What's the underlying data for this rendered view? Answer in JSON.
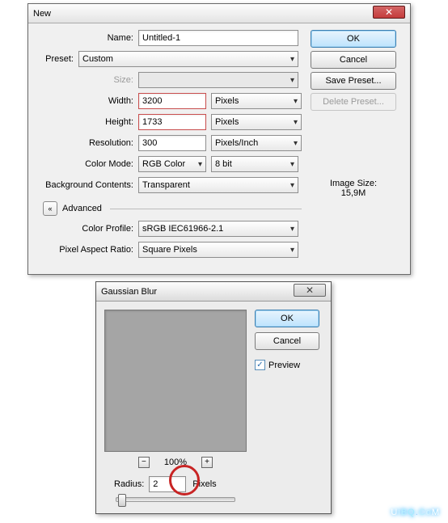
{
  "dlg1": {
    "title": "New",
    "name_label": "Name:",
    "name_value": "Untitled-1",
    "preset_label": "Preset:",
    "preset_value": "Custom",
    "size_label": "Size:",
    "size_value": "",
    "width_label": "Width:",
    "width_value": "3200",
    "width_unit": "Pixels",
    "height_label": "Height:",
    "height_value": "1733",
    "height_unit": "Pixels",
    "resolution_label": "Resolution:",
    "resolution_value": "300",
    "resolution_unit": "Pixels/Inch",
    "colormode_label": "Color Mode:",
    "colormode_value": "RGB Color",
    "colordepth_value": "8 bit",
    "bgcontents_label": "Background Contents:",
    "bgcontents_value": "Transparent",
    "advanced_label": "Advanced",
    "colorprofile_label": "Color Profile:",
    "colorprofile_value": "sRGB IEC61966-2.1",
    "pixelaspect_label": "Pixel Aspect Ratio:",
    "pixelaspect_value": "Square Pixels",
    "buttons": {
      "ok": "OK",
      "cancel": "Cancel",
      "save_preset": "Save Preset...",
      "delete_preset": "Delete Preset..."
    },
    "image_size_label": "Image Size:",
    "image_size_value": "15,9M"
  },
  "dlg2": {
    "title": "Gaussian Blur",
    "buttons": {
      "ok": "OK",
      "cancel": "Cancel"
    },
    "preview_label": "Preview",
    "preview_checked": true,
    "zoom_level": "100%",
    "radius_label": "Radius:",
    "radius_value": "2",
    "radius_unit": "Pixels"
  },
  "watermark": "UiBQ.CoM"
}
